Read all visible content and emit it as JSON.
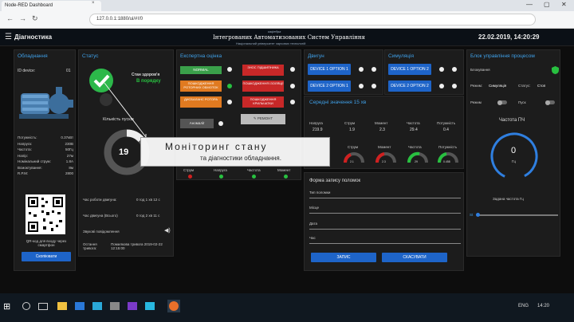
{
  "browser": {
    "tab_title": "Node-RED Dashboard",
    "tab_close": "×",
    "url": "127.0.0.1:1880/ui/#!/0",
    "nav": {
      "back": "←",
      "forward": "→",
      "reload": "↻"
    },
    "window": {
      "minimize": "—",
      "maximize": "▢",
      "close": "✕"
    }
  },
  "appbar": {
    "menu_icon": "☰",
    "title": "Діагностика",
    "date": "22.02.2019, 14:20:29",
    "banner_top": "кафедра",
    "banner_main": "Інтегрованих Автоматизованих Систем Управління",
    "banner_sub": "Національний університет харчових технологій"
  },
  "equipment": {
    "title": "Обладнання",
    "id_label": "ID device:",
    "id_value": "01",
    "params": [
      {
        "label": "Потужність:",
        "value": "0.37кВт"
      },
      {
        "label": "Напруга:",
        "value": "230В"
      },
      {
        "label": "Частота:",
        "value": "50Гц"
      },
      {
        "label": "Напір:",
        "value": "27м"
      },
      {
        "label": "Номінальний струм:",
        "value": "1.8А"
      },
      {
        "label": "Всмоктування:",
        "value": "8м"
      },
      {
        "label": "R.P.M:",
        "value": "2800"
      }
    ],
    "qr_caption": "QR-код для входу через смартфон",
    "copy_button": "Скопіювати"
  },
  "status": {
    "title": "Статус",
    "health_label": "Стан здоров'я",
    "health_value": "В порядку",
    "starts_label": "Кількість пусків",
    "starts_value": "19",
    "runtime_label": "Час роботи двигуна:",
    "runtime_value": "0 год 1 хв 12 с",
    "total_label": "Час двигуна (Всього)",
    "total_value": "0 год 2 хв 11 с",
    "sound_label": "Звукові повідомлення",
    "last_label": "Остання тривога:",
    "last_value": "Помилкова тривога 2019-02-22 12:15:00"
  },
  "expert": {
    "title": "Експертна оцінка",
    "left_buttons": [
      "NORMAL",
      "ПОШКОДЖЕННЯ РОТОРНИХ ОБМОТОК",
      "ДИСБАЛАНС РОТОРА",
      "Аномалії"
    ],
    "right_buttons": [
      "ЗНОС ПІДШИПНИКА",
      "ПОШКОДЖЕННЯ ІЗОЛЯЦІЇ",
      "ПОШКОДЖЕННЯ КРИЛЬЧАТКИ"
    ],
    "repair_button": "РЕМОНТ",
    "indicator_labels": [
      "Струм",
      "Напруга",
      "Частота",
      "Момент"
    ]
  },
  "engine": {
    "title": "Двигун",
    "options": [
      "DEVICE 1 OPTION 1",
      "DEVICE 2 OPTION 1"
    ]
  },
  "simulation": {
    "title": "Симуляція",
    "options": [
      "DEVICE 1 OPTION 2",
      "DEVICE 2 OPTION 2"
    ]
  },
  "averages": {
    "title": "Середні значення 15 хв",
    "columns": [
      "Напруга",
      "Струм",
      "Момент",
      "Частота",
      "Потужність"
    ],
    "values": [
      "219.9",
      "1.9",
      "2.3",
      "29.4",
      "0.4"
    ],
    "gauge_labels": [
      "Струм",
      "Момент",
      "Частота",
      "Потужність"
    ],
    "gauge_values": [
      "2.1",
      "2.3",
      "29",
      "0.458"
    ]
  },
  "fault_form": {
    "title": "Форма запису поломок",
    "fields": [
      "Тип поломки",
      "Місце",
      "Дата",
      "Час"
    ],
    "submit": "ЗАПИС",
    "cancel": "СКАСУВАТИ"
  },
  "control": {
    "title": "Блок управління процесом",
    "lock_label": "Блокування",
    "mode_label": "Режим:",
    "mode_value": "Симуляція",
    "status_label": "Статус:",
    "status_value": "Стоп",
    "toggle_mode": "Режим",
    "toggle_start": "Пуск",
    "freq_title": "Частота ПЧ",
    "freq_value": "0",
    "freq_unit": "Гц",
    "setpoint_label": "Задана частота  Гц",
    "slider_value": "St"
  },
  "caption": {
    "line1": "Моніторинг стану",
    "line2": "та діагностики обладнання."
  },
  "taskbar": {
    "lang": "ENG",
    "time": "14:20"
  },
  "colors": {
    "accent": "#3fa0e8",
    "ok": "#28c040",
    "alarm": "#d02020",
    "button": "#1e64c8"
  }
}
